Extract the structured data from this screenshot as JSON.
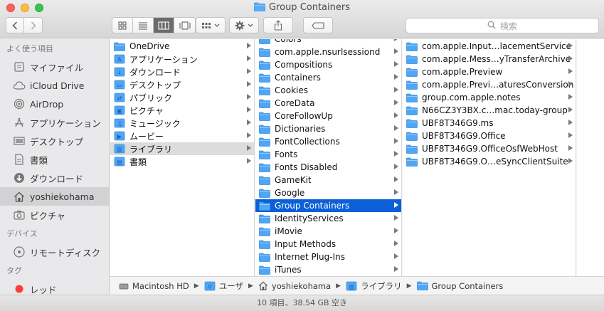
{
  "window": {
    "title": "Group Containers"
  },
  "toolbar": {
    "search_placeholder": "検索"
  },
  "sidebar": {
    "favorites_header": "よく使う項目",
    "favorites": [
      {
        "label": "マイファイル",
        "icon": "all-files-icon"
      },
      {
        "label": "iCloud Drive",
        "icon": "cloud-icon"
      },
      {
        "label": "AirDrop",
        "icon": "airdrop-icon"
      },
      {
        "label": "アプリケーション",
        "icon": "applications-icon"
      },
      {
        "label": "デスクトップ",
        "icon": "desktop-icon"
      },
      {
        "label": "書類",
        "icon": "documents-icon"
      },
      {
        "label": "ダウンロード",
        "icon": "downloads-icon"
      },
      {
        "label": "yoshiekohama",
        "icon": "home-icon"
      },
      {
        "label": "ピクチャ",
        "icon": "camera-icon"
      }
    ],
    "devices_header": "デバイス",
    "devices": [
      {
        "label": "リモートディスク",
        "icon": "disc-icon"
      }
    ],
    "tags_header": "タグ",
    "tags": [
      {
        "label": "レッド",
        "color": "#fc3d39"
      }
    ]
  },
  "column1": [
    {
      "label": "OneDrive",
      "arrow": true
    },
    {
      "label": "アプリケーション",
      "arrow": true
    },
    {
      "label": "ダウンロード",
      "arrow": true
    },
    {
      "label": "デスクトップ",
      "arrow": true
    },
    {
      "label": "パブリック",
      "arrow": true
    },
    {
      "label": "ピクチャ",
      "arrow": true
    },
    {
      "label": "ミュージック",
      "arrow": true
    },
    {
      "label": "ムービー",
      "arrow": true
    },
    {
      "label": "ライブラリ",
      "arrow": true
    },
    {
      "label": "書類",
      "arrow": true
    }
  ],
  "column2": [
    {
      "label": "Colors",
      "arrow": true
    },
    {
      "label": "com.apple.nsurlsessiond",
      "arrow": true
    },
    {
      "label": "Compositions",
      "arrow": true
    },
    {
      "label": "Containers",
      "arrow": true
    },
    {
      "label": "Cookies",
      "arrow": true
    },
    {
      "label": "CoreData",
      "arrow": true
    },
    {
      "label": "CoreFollowUp",
      "arrow": true
    },
    {
      "label": "Dictionaries",
      "arrow": true
    },
    {
      "label": "FontCollections",
      "arrow": true
    },
    {
      "label": "Fonts",
      "arrow": true
    },
    {
      "label": "Fonts Disabled",
      "arrow": true
    },
    {
      "label": "GameKit",
      "arrow": true
    },
    {
      "label": "Google",
      "arrow": true
    },
    {
      "label": "Group Containers",
      "arrow": true
    },
    {
      "label": "IdentityServices",
      "arrow": true
    },
    {
      "label": "iMovie",
      "arrow": true
    },
    {
      "label": "Input Methods",
      "arrow": true
    },
    {
      "label": "Internet Plug-Ins",
      "arrow": true
    },
    {
      "label": "iTunes",
      "arrow": true
    }
  ],
  "column3": [
    {
      "label": "com.apple.Input…lacementService",
      "arrow": true
    },
    {
      "label": "com.apple.Mess…yTransferArchive",
      "arrow": true
    },
    {
      "label": "com.apple.Preview",
      "arrow": true
    },
    {
      "label": "com.apple.Previ…aturesConversion",
      "arrow": true
    },
    {
      "label": "group.com.apple.notes",
      "arrow": true
    },
    {
      "label": "N66CZ3Y3BX.c…mac.today-group",
      "arrow": true
    },
    {
      "label": "UBF8T346G9.ms",
      "arrow": true
    },
    {
      "label": "UBF8T346G9.Office",
      "arrow": true
    },
    {
      "label": "UBF8T346G9.OfficeOsfWebHost",
      "arrow": true
    },
    {
      "label": "UBF8T346G9.O…eSyncClientSuite",
      "arrow": true
    }
  ],
  "pathbar": [
    "Macintosh HD",
    "ユーザ",
    "yoshiekohama",
    "ライブラリ",
    "Group Containers"
  ],
  "status": "10 項目、38.54 GB 空き",
  "colors": {
    "selection_blue": "#0b60d8",
    "folder_blue": "#4fa6f5"
  }
}
